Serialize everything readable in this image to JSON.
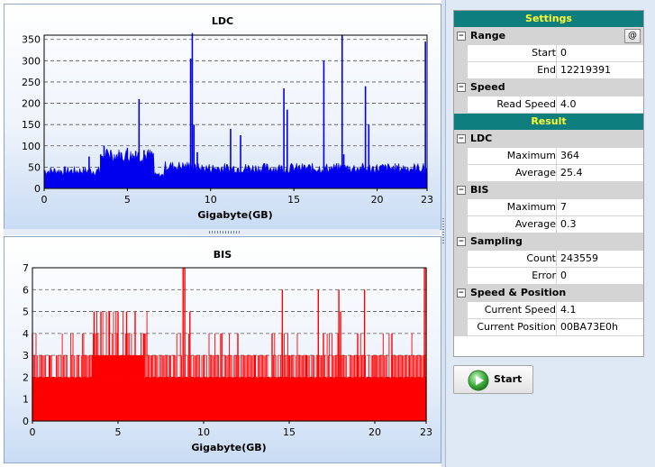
{
  "charts": {
    "ldc": {
      "title": "LDC",
      "xlabel": "Gigabyte(GB)",
      "yticks": [
        "0",
        "50",
        "100",
        "150",
        "200",
        "250",
        "300",
        "350"
      ],
      "xticks": [
        "0",
        "5",
        "10",
        "15",
        "20",
        "23"
      ]
    },
    "bis": {
      "title": "BIS",
      "xlabel": "Gigabyte(GB)",
      "yticks": [
        "0",
        "1",
        "2",
        "3",
        "4",
        "5",
        "6",
        "7"
      ],
      "xticks": [
        "0",
        "5",
        "10",
        "15",
        "20",
        "23"
      ]
    }
  },
  "chart_data": [
    {
      "type": "bar",
      "title": "LDC",
      "xlabel": "Gigabyte(GB)",
      "ylabel": "",
      "xlim": [
        0,
        23
      ],
      "ylim": [
        0,
        360
      ],
      "grid": true,
      "color": "#0000ee",
      "x": [
        0,
        0.5,
        1,
        1.5,
        2,
        2.5,
        2.7,
        3,
        3.4,
        3.6,
        4,
        4.5,
        5,
        5.5,
        5.7,
        6,
        6.5,
        7,
        7.5,
        8,
        8.5,
        8.8,
        8.9,
        9,
        9.2,
        9.5,
        10,
        10.5,
        11,
        11.2,
        11.8,
        12,
        12.5,
        13,
        13.5,
        14,
        14.4,
        14.6,
        15,
        15.5,
        16,
        16.5,
        16.8,
        17,
        17.5,
        17.9,
        18,
        18.5,
        19,
        19.3,
        19.5,
        20,
        20.5,
        21,
        21.5,
        22,
        22.5,
        22.9,
        23
      ],
      "values": [
        40,
        42,
        38,
        44,
        40,
        45,
        75,
        45,
        80,
        100,
        90,
        85,
        95,
        88,
        210,
        90,
        80,
        60,
        45,
        55,
        70,
        305,
        365,
        150,
        85,
        65,
        55,
        50,
        60,
        140,
        125,
        45,
        50,
        55,
        60,
        40,
        235,
        185,
        70,
        50,
        55,
        60,
        300,
        70,
        60,
        360,
        80,
        60,
        55,
        240,
        150,
        70,
        60,
        70,
        60,
        55,
        50,
        345,
        45
      ],
      "description_of_baseline": "dense noise 25-60 with elevated band 3.4-6.5 GB"
    },
    {
      "type": "bar",
      "title": "BIS",
      "xlabel": "Gigabyte(GB)",
      "ylabel": "",
      "xlim": [
        0,
        23
      ],
      "ylim": [
        0,
        7
      ],
      "grid": true,
      "color": "#ff0000",
      "x": [
        0,
        1,
        2,
        3,
        3.6,
        4,
        4.5,
        5,
        5.5,
        6,
        6.5,
        7,
        8,
        8.8,
        8.9,
        9.2,
        10,
        11,
        12,
        13,
        14,
        14.6,
        15,
        16,
        16.7,
        17,
        17.9,
        18,
        19,
        19.4,
        20,
        21,
        22,
        22.9,
        23
      ],
      "values": [
        4,
        3,
        3,
        3,
        5,
        5,
        5,
        5,
        5,
        5,
        4,
        3,
        3,
        7,
        7,
        5,
        3,
        4,
        4,
        3,
        4,
        6,
        3,
        3,
        6,
        4,
        6,
        5,
        4,
        6,
        3,
        4,
        3,
        7,
        7
      ]
    }
  ],
  "settings": {
    "header": "Settings",
    "range": {
      "label": "Range",
      "at_button": "@",
      "start_label": "Start",
      "start_value": "0",
      "end_label": "End",
      "end_value": "12219391"
    },
    "speed": {
      "label": "Speed",
      "read_speed_label": "Read Speed",
      "read_speed_value": "4.0"
    }
  },
  "result": {
    "header": "Result",
    "ldc": {
      "label": "LDC",
      "max_label": "Maximum",
      "max_value": "364",
      "avg_label": "Average",
      "avg_value": "25.4"
    },
    "bis": {
      "label": "BIS",
      "max_label": "Maximum",
      "max_value": "7",
      "avg_label": "Average",
      "avg_value": "0.3"
    },
    "sampling": {
      "label": "Sampling",
      "count_label": "Count",
      "count_value": "243559",
      "error_label": "Error",
      "error_value": "0"
    },
    "speed_position": {
      "label": "Speed & Position",
      "cur_speed_label": "Current Speed",
      "cur_speed_value": "4.1",
      "cur_pos_label": "Current Position",
      "cur_pos_value": "00BA73E0h"
    }
  },
  "start_button": {
    "label": "Start",
    "icon": "play-icon"
  },
  "colors": {
    "ldc": "#0000ee",
    "bis": "#ff0000",
    "header_bg": "#0f7e7e",
    "header_fg": "#ffff33"
  }
}
